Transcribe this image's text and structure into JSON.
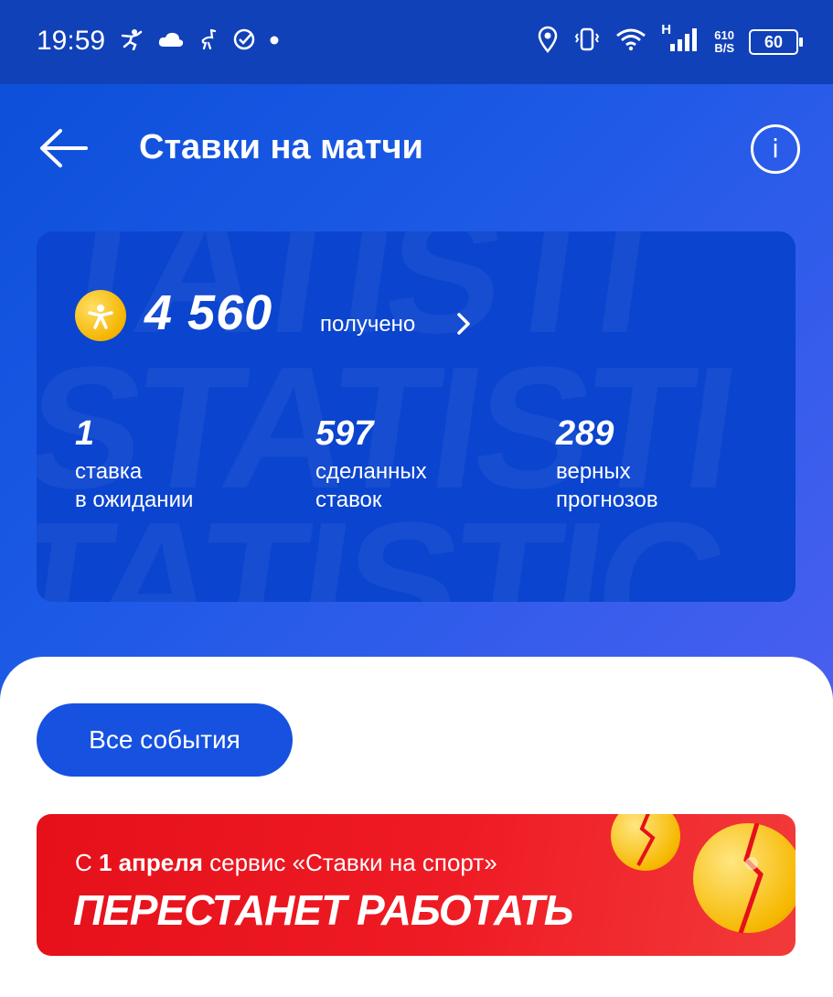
{
  "statusbar": {
    "time": "19:59",
    "network_type": "H",
    "speed_value": "610",
    "speed_unit": "B/S",
    "battery": "60",
    "icons_left": [
      "runner-icon",
      "cloud-icon",
      "ostrich-icon",
      "check-circle-icon",
      "dot-icon"
    ],
    "icons_right": [
      "location-icon",
      "vibrate-icon",
      "wifi-icon",
      "signal-icon"
    ]
  },
  "header": {
    "title": "Ставки на матчи",
    "back_icon": "arrow-left-icon",
    "info_icon": "info-icon"
  },
  "stats_card": {
    "watermark": "STATISTICS",
    "coins_amount": "4 560",
    "coins_label": "получено",
    "items": [
      {
        "value": "1",
        "label_line1": "ставка",
        "label_line2": "в ожидании"
      },
      {
        "value": "597",
        "label_line1": "сделанных",
        "label_line2": "ставок"
      },
      {
        "value": "289",
        "label_line1": "верных",
        "label_line2": "прогнозов"
      }
    ]
  },
  "filter": {
    "all_events_label": "Все события"
  },
  "banner": {
    "line1_prefix": "С ",
    "line1_bold": "1 апреля",
    "line1_suffix": " сервис «Ставки на спорт»",
    "line2": "ПЕРЕСТАНЕТ РАБОТАТЬ"
  },
  "colors": {
    "accent_blue": "#1651e0",
    "statusbar_blue": "#1141b8",
    "card_blue": "#0a44cf",
    "banner_red": "#e5101a",
    "coin_gold": "#f4b400"
  }
}
